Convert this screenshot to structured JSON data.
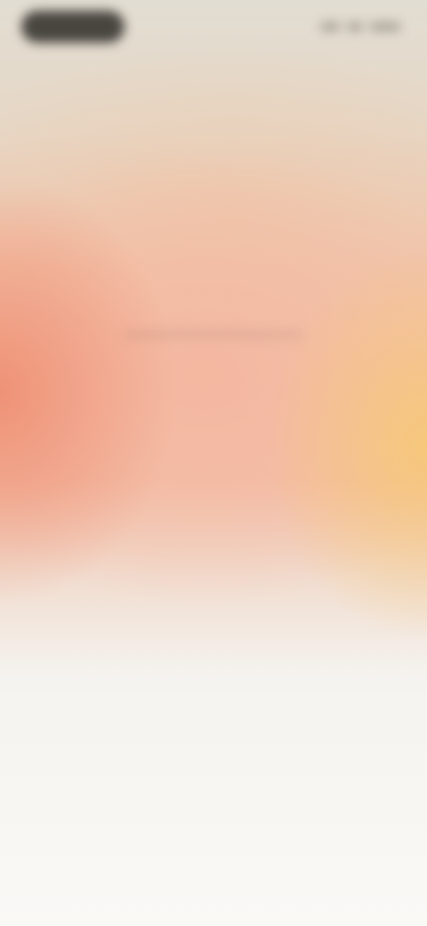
{
  "screen": {
    "headline": "",
    "state": "blurred"
  },
  "status_bar": {
    "left_pill": "dark-pill",
    "right_icons": [
      "signal-icon",
      "wifi-icon",
      "battery-icon"
    ]
  },
  "colors": {
    "coral": "#ee8a6e",
    "peach": "#f4b6a0",
    "amber": "#f6c878",
    "top_gray": "#e2ddd2",
    "bottom_white": "#faf9f6"
  }
}
